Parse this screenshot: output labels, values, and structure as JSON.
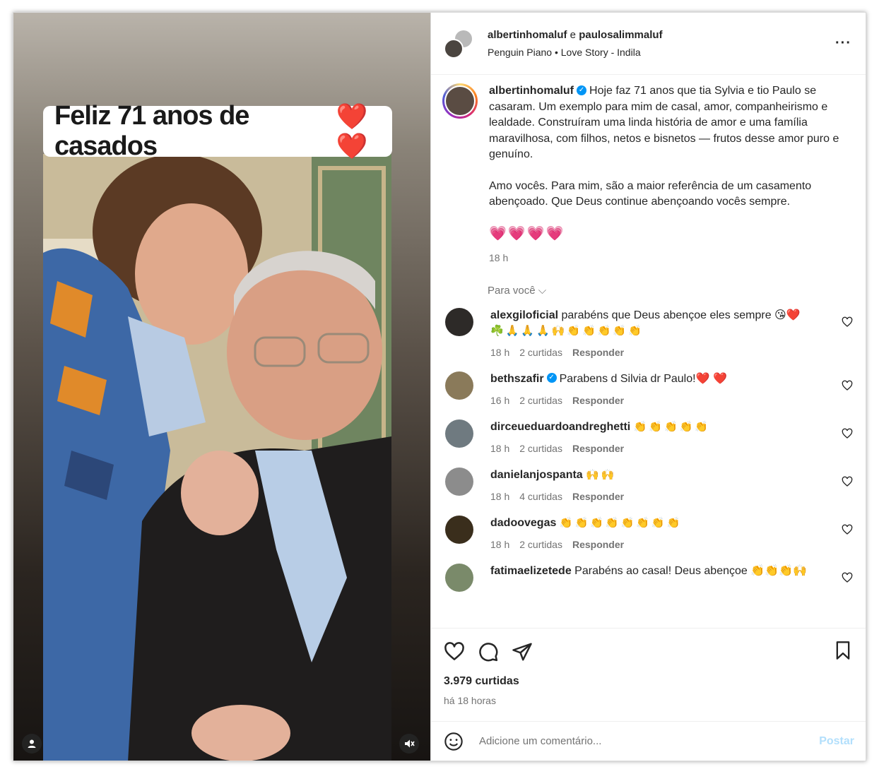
{
  "media": {
    "caption_text": "Feliz 71 anos de casados",
    "caption_hearts": "❤️❤️"
  },
  "header": {
    "user1": "albertinhomaluf",
    "connector": " e ",
    "user2": "paulosalimmaluf",
    "audio_artist": "Penguin Piano",
    "audio_sep": " • ",
    "audio_track": "Love Story - Indila",
    "more": "···"
  },
  "caption": {
    "username": "albertinhomaluf",
    "text1": "Hoje faz 71 anos que tia Sylvia e tio Paulo se casaram. Um exemplo para mim de casal, amor, companheirismo e lealdade. Construíram uma linda história de amor e uma família maravilhosa, com filhos, netos e bisnetos — frutos desse amor puro e genuíno.",
    "text2": "Amo vocês. Para mim, são a maior referência de um casamento abençoado. Que Deus continue abençoando vocês sempre.",
    "hearts": "💗💗💗💗",
    "time": "18 h"
  },
  "for_you": "Para você ⌵",
  "comments": [
    {
      "username": "alexgiloficial",
      "text": "parabéns que Deus abençoe eles sempre 😘❤️",
      "text2": "☘️🙏🙏🙏🙌👏👏👏👏👏",
      "time": "18 h",
      "likes": "2 curtidas",
      "reply": "Responder",
      "avatar": "#2d2a28"
    },
    {
      "username": "bethszafir",
      "text": "Parabens d Silvia dr Paulo!❤️ ❤️",
      "time": "16 h",
      "likes": "2 curtidas",
      "reply": "Responder",
      "avatar": "#8a7a5a"
    },
    {
      "username": "dirceueduardoandreghetti",
      "text": "👏👏👏👏👏",
      "time": "18 h",
      "likes": "2 curtidas",
      "reply": "Responder",
      "avatar": "#6f7a80"
    },
    {
      "username": "danielanjospanta",
      "text": "🙌🙌",
      "time": "18 h",
      "likes": "4 curtidas",
      "reply": "Responder",
      "avatar": "#8c8c8c"
    },
    {
      "username": "dadoovegas",
      "text": "👏👏👏👏👏👏👏👏",
      "time": "18 h",
      "likes": "2 curtidas",
      "reply": "Responder",
      "avatar": "#3a2e1c"
    },
    {
      "username": "fatimaelizetede",
      "text": "Parabéns ao casal! Deus abençoe 👏👏👏🙌",
      "time": "",
      "likes": "",
      "reply": "",
      "avatar": "#7a8a6a"
    }
  ],
  "actions": {
    "likes": "3.979 curtidas",
    "ago": "há 18 horas"
  },
  "composer": {
    "placeholder": "Adicione um comentário...",
    "post": "Postar"
  }
}
